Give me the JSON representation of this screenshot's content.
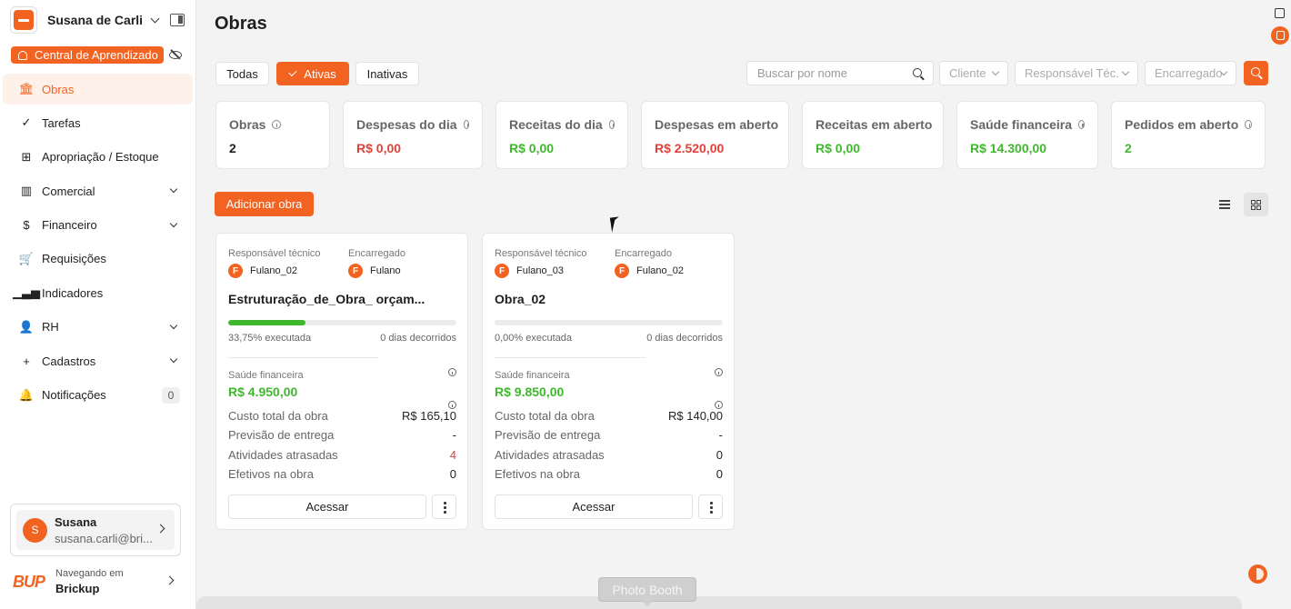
{
  "sidebar": {
    "company": "Susana de Carli",
    "learning_center": "Central de Aprendizado",
    "nav": [
      {
        "label": "Obras",
        "icon": "bank-icon",
        "active": true
      },
      {
        "label": "Tarefas",
        "icon": "check-circle-icon"
      },
      {
        "label": "Apropriação / Estoque",
        "icon": "grid-icon"
      },
      {
        "label": "Comercial",
        "icon": "barcode-icon",
        "expandable": true
      },
      {
        "label": "Financeiro",
        "icon": "dollar-icon",
        "expandable": true
      },
      {
        "label": "Requisições",
        "icon": "cart-icon"
      },
      {
        "label": "Indicadores",
        "icon": "bar-chart-icon"
      },
      {
        "label": "RH",
        "icon": "user-icon",
        "expandable": true
      },
      {
        "label": "Cadastros",
        "icon": "plus-icon",
        "expandable": true
      },
      {
        "label": "Notificações",
        "icon": "bell-icon",
        "badge": "0"
      }
    ],
    "user": {
      "initial": "S",
      "name": "Susana",
      "email": "susana.carli@bri..."
    },
    "org": {
      "logo": "BUP",
      "caption": "Navegando em",
      "name": "Brickup"
    }
  },
  "header": {
    "title": "Obras"
  },
  "filters": {
    "tabs": [
      "Todas",
      "Ativas",
      "Inativas"
    ],
    "active_tab": "Ativas",
    "search_placeholder": "Buscar por nome",
    "selects": [
      "Cliente",
      "Responsável Téc.",
      "Encarregado"
    ]
  },
  "stats": [
    {
      "label": "Obras",
      "value": "2",
      "info": true
    },
    {
      "label": "Despesas do dia",
      "value": "R$ 0,00",
      "info": true,
      "color": "#e0413a"
    },
    {
      "label": "Receitas do dia",
      "value": "R$ 0,00",
      "info": true,
      "color": "#3fb82d"
    },
    {
      "label": "Despesas em aberto",
      "value": "R$ 2.520,00",
      "color": "#e0413a"
    },
    {
      "label": "Receitas em aberto",
      "value": "R$ 0,00",
      "color": "#3fb82d"
    },
    {
      "label": "Saúde financeira",
      "value": "R$ 14.300,00",
      "info": true,
      "color": "#3fb82d"
    },
    {
      "label": "Pedidos em aberto",
      "value": "2",
      "info": true,
      "color": "#3fb82d"
    }
  ],
  "actions": {
    "add_label": "Adicionar obra"
  },
  "labels": {
    "tech": "Responsável técnico",
    "foreman": "Encarregado",
    "health": "Saúde financeira",
    "total_cost": "Custo total da obra",
    "delivery": "Previsão de entrega",
    "late": "Atividades atrasadas",
    "staff": "Efetivos na obra",
    "access": "Acessar"
  },
  "obras": [
    {
      "tech": "Fulano_02",
      "foreman": "Fulano",
      "name": "Estruturação_de_Obra_ orçam...",
      "progress_pct": 33.75,
      "executed": "33,75% executada",
      "elapsed": "0 dias decorridos",
      "health": "R$ 4.950,00",
      "total_cost": "R$ 165,10",
      "delivery": "-",
      "late": "4",
      "staff": "0"
    },
    {
      "tech": "Fulano_03",
      "foreman": "Fulano_02",
      "name": "Obra_02",
      "progress_pct": 0,
      "executed": "0,00% executada",
      "elapsed": "0 dias decorridos",
      "health": "R$ 9.850,00",
      "total_cost": "R$ 140,00",
      "delivery": "-",
      "late": "0",
      "staff": "0"
    }
  ],
  "overlay": {
    "tooltip": "Photo Booth"
  },
  "colors": {
    "accent": "#f26322",
    "positive": "#3fb82d",
    "negative": "#e0413a"
  }
}
